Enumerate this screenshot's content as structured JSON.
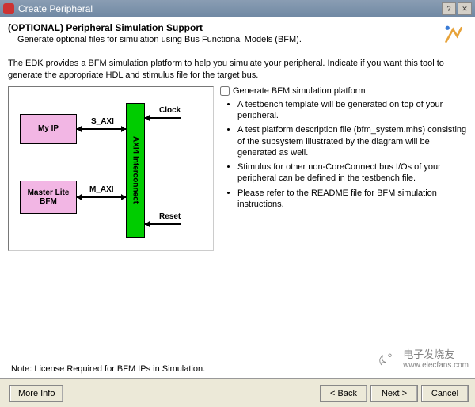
{
  "window": {
    "title": "Create Peripheral"
  },
  "header": {
    "title": "(OPTIONAL) Peripheral Simulation Support",
    "subtitle": "Generate optional files for simulation using Bus Functional Models (BFM)."
  },
  "intro": "The EDK provides a BFM simulation platform to help you simulate your peripheral. Indicate if you want this tool to generate the appropriate HDL and stimulus file for the target bus.",
  "checkbox": {
    "label": "Generate BFM simulation platform",
    "checked": false
  },
  "bullets": [
    "A testbench template will be generated on top of your peripheral.",
    "A test platform description file (bfm_system.mhs) consisting of the subsystem illustrated by the diagram will be generated as well.",
    "Stimulus for other non-CoreConnect bus I/Os of your peripheral can be defined in the testbench file.",
    "Please refer to the README file for BFM simulation instructions."
  ],
  "diagram": {
    "block_my_ip": "My IP",
    "block_master": "Master Lite\nBFM",
    "interconnect": "AXI4 Interconnect",
    "sig_s_axi": "S_AXI",
    "sig_m_axi": "M_AXI",
    "sig_clock": "Clock",
    "sig_reset": "Reset"
  },
  "note": "Note: License Required for BFM IPs in Simulation.",
  "footer": {
    "more_info": "More Info",
    "back": "< Back",
    "next": "Next >",
    "cancel": "Cancel"
  },
  "watermark": {
    "text": "电子发烧友",
    "url": "www.elecfans.com"
  }
}
